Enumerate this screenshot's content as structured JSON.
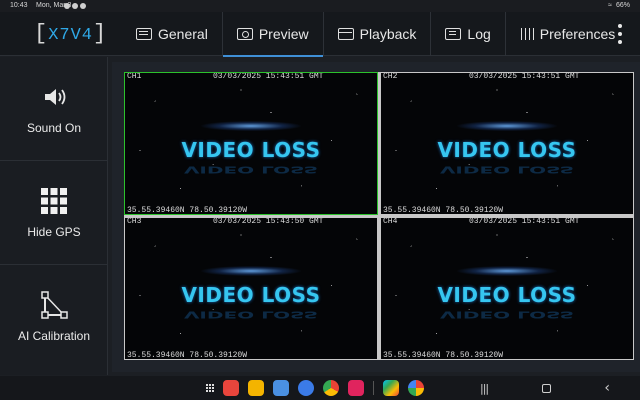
{
  "status_bar": {
    "time": "10:43",
    "date": "Mon, Mar 3",
    "battery": "66%"
  },
  "app": {
    "logo": "X7V4"
  },
  "tabs": [
    {
      "label": "General",
      "icon": "general-icon",
      "active": false
    },
    {
      "label": "Preview",
      "icon": "preview-icon",
      "active": true
    },
    {
      "label": "Playback",
      "icon": "playback-icon",
      "active": false
    },
    {
      "label": "Log",
      "icon": "log-icon",
      "active": false
    },
    {
      "label": "Preferences",
      "icon": "preferences-icon",
      "active": false
    }
  ],
  "sidebar": {
    "items": [
      {
        "label": "Sound On",
        "icon": "speaker-icon"
      },
      {
        "label": "Hide GPS",
        "icon": "grid-icon"
      },
      {
        "label": "AI Calibration",
        "icon": "calibration-icon"
      }
    ]
  },
  "cameras": [
    {
      "channel": "CH1",
      "timestamp": "03/03/2025 15:43:51 GMT",
      "message": "VIDEO LOSS",
      "gps": "35.55.39460N 78.50.39120W",
      "selected": true
    },
    {
      "channel": "CH2",
      "timestamp": "03/03/2025 15:43:51 GMT",
      "message": "VIDEO LOSS",
      "gps": "35.55.39460N 78.50.39120W",
      "selected": false
    },
    {
      "channel": "CH3",
      "timestamp": "03/03/2025 15:43:50 GMT",
      "message": "VIDEO LOSS",
      "gps": "35.55.39460N 78.50.39120W",
      "selected": false
    },
    {
      "channel": "CH4",
      "timestamp": "03/03/2025 15:43:51 GMT",
      "message": "VIDEO LOSS",
      "gps": "35.55.39460N 78.50.39120W",
      "selected": false
    }
  ],
  "colors": {
    "accent": "#3f8fd6",
    "selected_border": "#2cc22c",
    "video_loss_text": "#36c6f0"
  },
  "dock_apps": [
    "app-red",
    "app-folder",
    "app-calendar",
    "app-chat",
    "app-chrome",
    "app-camera",
    "app-play-store",
    "app-photos"
  ]
}
